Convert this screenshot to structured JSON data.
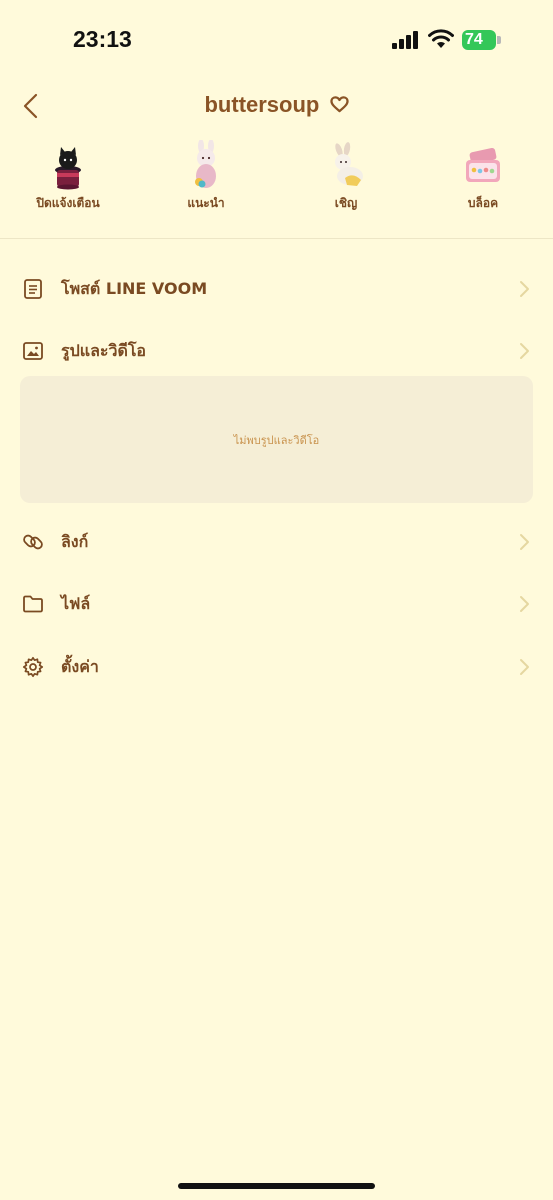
{
  "status_bar": {
    "time": "23:13",
    "battery": "74"
  },
  "header": {
    "title": "buttersoup"
  },
  "actions": [
    {
      "label": "ปิดแจ้งเตือน",
      "icon": "cat-in-hat-icon"
    },
    {
      "label": "แนะนำ",
      "icon": "bunny-figure-icon"
    },
    {
      "label": "เชิญ",
      "icon": "bunny-crawling-icon"
    },
    {
      "label": "บล็อค",
      "icon": "toy-box-icon"
    }
  ],
  "menu": {
    "voom": {
      "label": "โพสต์ LINE VOOM"
    },
    "media": {
      "label": "รูปและวิดีโอ",
      "empty_message": "ไม่พบรูปและวิดีโอ"
    },
    "links": {
      "label": "ลิงก์"
    },
    "files": {
      "label": "ไฟล์"
    },
    "settings": {
      "label": "ตั้งค่า"
    }
  },
  "colors": {
    "background": "#FFFADB",
    "text": "#7A4A22",
    "muted": "#C9934E",
    "chevron": "#E5D7A0"
  }
}
